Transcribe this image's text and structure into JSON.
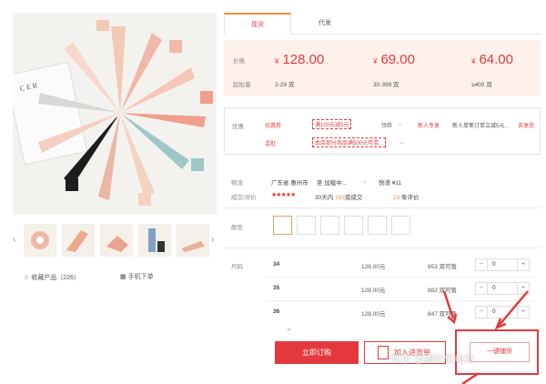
{
  "gallery": {
    "fav_label": "收藏产品（226）",
    "mobile_label": "手机下单",
    "thumb_count": 5
  },
  "tabs": [
    {
      "label": "现货"
    },
    {
      "label": "代发"
    }
  ],
  "price": {
    "price_label": "价格",
    "qty_label": "起批量",
    "currency": "¥",
    "tiers": [
      {
        "price": "128.00",
        "range": "2-29 双"
      },
      {
        "price": "69.00",
        "range": "30-399 双"
      },
      {
        "price": "64.00",
        "range": "≥400 双"
      }
    ]
  },
  "promo": {
    "label": "优惠",
    "row1": {
      "coupon_label": "优惠券",
      "coupon_value": "满100元减5元",
      "more": "领券",
      "newbie_label": "新人专享",
      "newbie_text": "新人单笔订单立减5元...",
      "newbie_link": "去享受"
    },
    "row2": {
      "label": "混批",
      "text": "本店部分商品满500元可混..."
    }
  },
  "info": {
    "logistics_label": "物流",
    "origin": "广东省 惠州市",
    "dest": "至 加载中...",
    "freight": "快递 ¥11",
    "deals_label": "成交/评价",
    "stars": "★★★★★",
    "deals_prefix": "30天内",
    "deals_count": "153",
    "deals_suffix": "双成交",
    "reviews_count": "23",
    "reviews_suffix": "条评价"
  },
  "color": {
    "label": "颜色",
    "swatches": 6
  },
  "sizes": {
    "label": "尺码",
    "rows": [
      {
        "size": "34",
        "price": "128.00元",
        "stock": "953 双可售",
        "qty": "0"
      },
      {
        "size": "35",
        "price": "128.00元",
        "stock": "882 双可售",
        "qty": "0"
      },
      {
        "size": "36",
        "price": "128.00元",
        "stock": "847 双可售",
        "qty": "0"
      }
    ]
  },
  "actions": {
    "order": "立即订购",
    "cart": "加入进货单",
    "third": "一键铺货"
  },
  "watermark": "知乎 @跟险侃电商",
  "colors": {
    "accent": "#e4393c",
    "price_bg": "#fdf1e9",
    "highlight_orange": "#f08c3c"
  }
}
